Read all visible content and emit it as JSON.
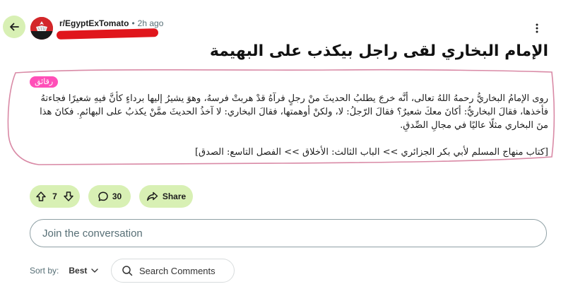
{
  "post": {
    "subreddit": "r/EgyptExTomato",
    "separator": "•",
    "time": "2h ago",
    "title": "الإمام البخاري لقى راجل بيكذب على البهيمة",
    "flair": "رقائق",
    "body": "روى الإمامُ البخاريُّ رحمهُ اللهُ تعالى، أنَّه خرجَ يطلبُ الحديثَ منْ رجلٍ فرآهُ قدْ هربتْ فرسهُ، وهوَ يشيرُ إليها برداءٍ كأنَّ فيهِ شعيرًا فجاءتهُ فأخذها، فقالَ البخاريُّ: أكانَ معكَ شعيرٌ؟ فقالَ الرّجلُ: لا، ولكنْ أوهمتها، فقالَ البخاري: لا آخذُ الحديثَ ممَّنْ يكذبُ على البهائمِ. فكانَ هذا منَ البخاري مثلًا عاليًا في مجالِ الصِّدقِ.",
    "source": "[كتاب منهاج المسلم لأبي بكر الجزائري >> الباب الثالث: الأخلاق >> الفصل التاسع: الصدق]"
  },
  "actions": {
    "votes": "7",
    "comments": "30",
    "share": "Share"
  },
  "comments_area": {
    "join_placeholder": "Join the conversation",
    "sort_label": "Sort by:",
    "sort_value": "Best",
    "search_placeholder": "Search Comments"
  },
  "colors": {
    "accent_bg": "#d8f0b4",
    "flair_bg": "#ff4fb8",
    "redaction": "#e0161c",
    "outline_pink": "#d98aa6"
  },
  "icons": [
    "back-arrow-icon",
    "subreddit-avatar-icon",
    "more-options-icon",
    "upvote-icon",
    "downvote-icon",
    "comment-icon",
    "share-icon",
    "chevron-down-icon",
    "search-icon"
  ]
}
